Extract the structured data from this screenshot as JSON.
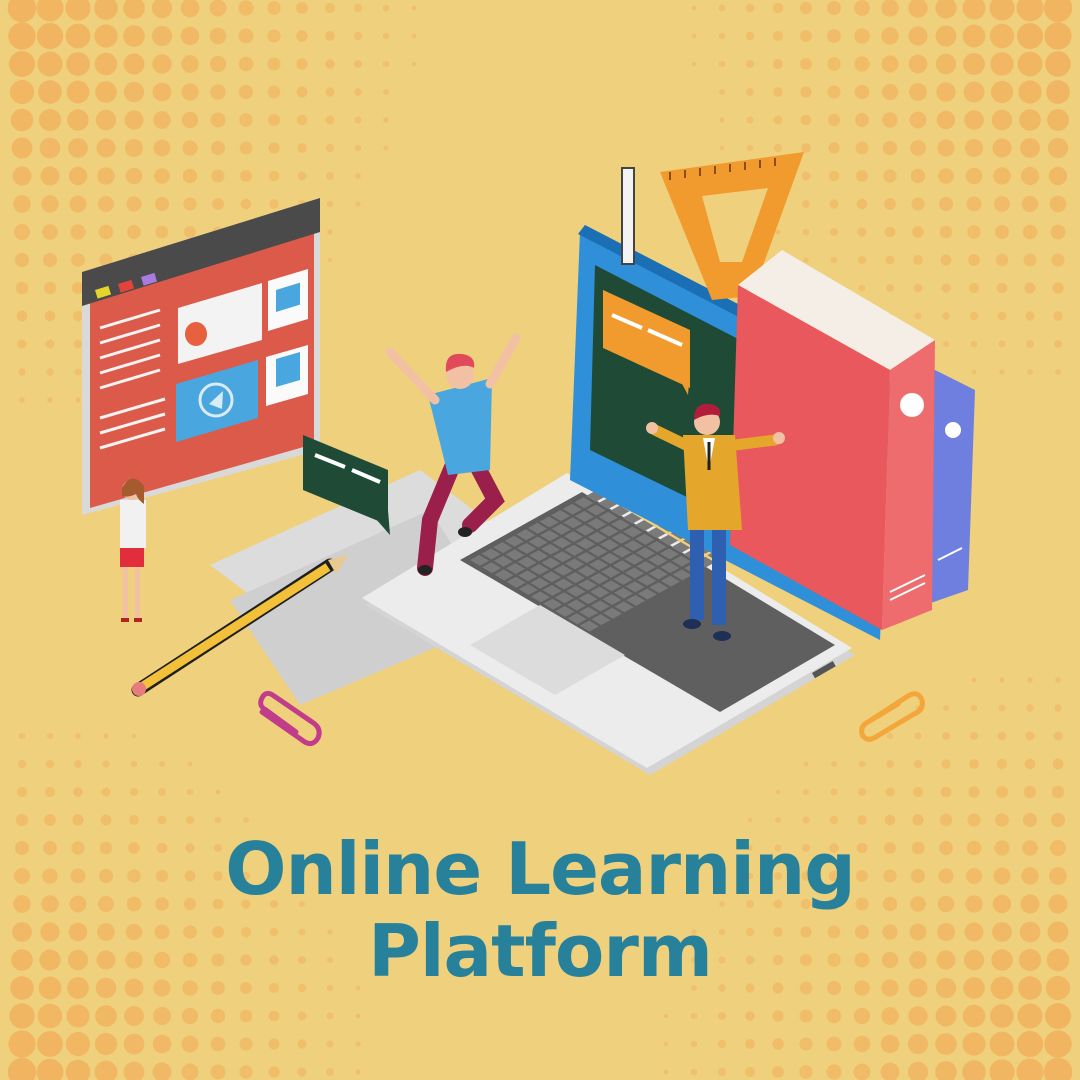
{
  "title": {
    "line1": "Online Learning",
    "line2": "Platform"
  },
  "colors": {
    "background": "#efd07c",
    "dots": "#f1b15e",
    "title": "#27819a",
    "browser_red": "#dc5a49",
    "laptop_blue": "#2f8fd8",
    "chalkboard": "#1e4a36",
    "book_pink": "#ee6b6e",
    "book_purple": "#6f7fe0",
    "ruler_orange": "#f19a2e",
    "clip_magenta": "#c23c8c",
    "clip_orange": "#f3a73b"
  },
  "icons": [
    "browser-window-icon",
    "play-icon",
    "briefcase-icon",
    "laptop-icon",
    "chalkboard-icon",
    "speech-bubble-icon",
    "book-icon",
    "triangle-ruler-icon",
    "pencil-icon",
    "paperclip-icon"
  ]
}
